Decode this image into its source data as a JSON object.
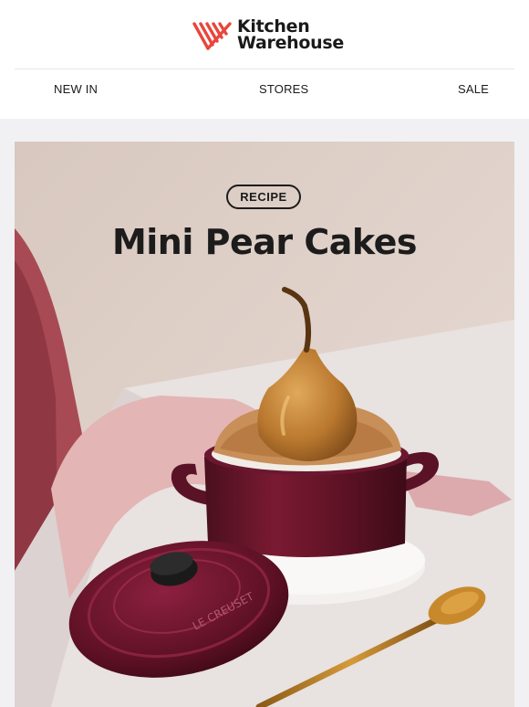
{
  "brand": {
    "line1": "Kitchen",
    "line2": "Warehouse",
    "accent": "#e8463c"
  },
  "nav": {
    "items": [
      "NEW IN",
      "STORES",
      "SALE"
    ]
  },
  "hero": {
    "badge": "RECIPE",
    "title": "Mini Pear Cakes",
    "image_alt": "Le Creuset mini cocotte with a pear cake",
    "lid_text": "LE CREUSET"
  }
}
